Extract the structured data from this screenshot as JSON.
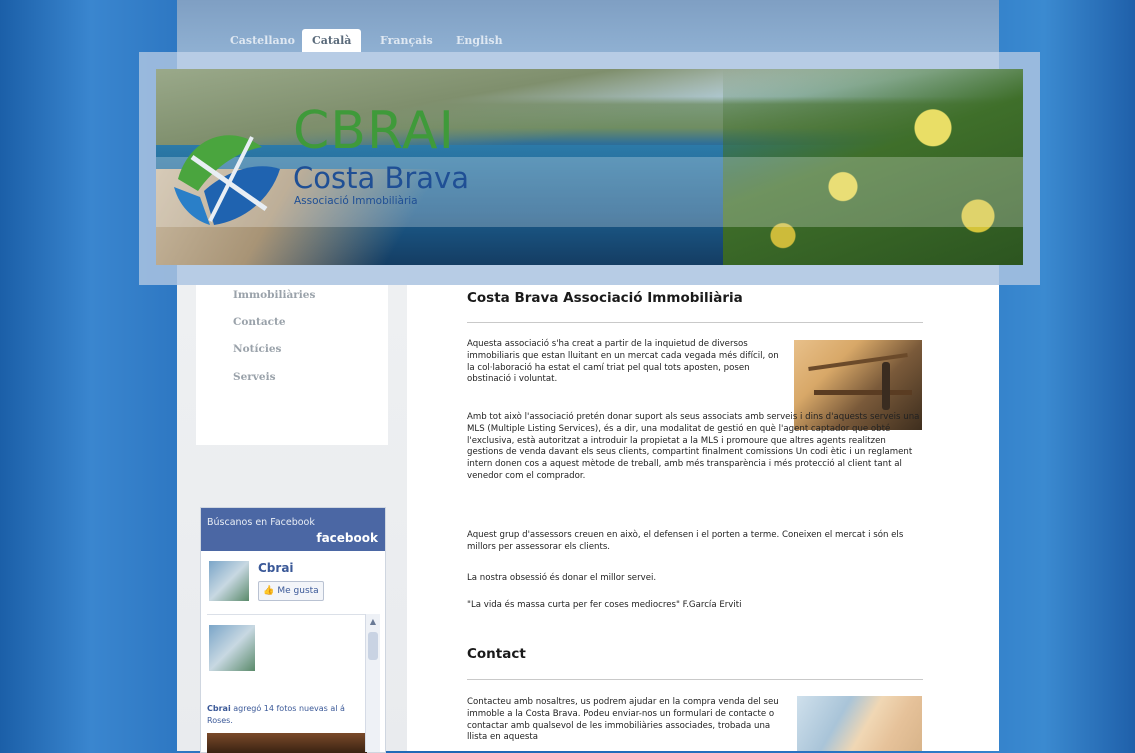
{
  "languages": [
    {
      "label": "Castellano",
      "active": false
    },
    {
      "label": "Català",
      "active": true
    },
    {
      "label": "Français",
      "active": false
    },
    {
      "label": "English",
      "active": false
    }
  ],
  "logo": {
    "cbrai": "CBRAI",
    "costa_brava": "Costa Brava",
    "subtitle": "Associació Immobiliària"
  },
  "menu": {
    "items": [
      "Immobiliàries",
      "Contacte",
      "Notícies",
      "Serveis"
    ]
  },
  "facebook": {
    "find_us": "Búscanos en Facebook",
    "brand": "facebook",
    "page_name": "Cbrai",
    "like_label": "Me gusta",
    "post_author": "Cbrai",
    "post_text": "agregó 14 fotos nuevas al á",
    "post_place": "Roses."
  },
  "main": {
    "title": "Costa Brava Associació Immobiliària",
    "paragraphs": [
      "Aquesta associació s'ha creat a partir de la inquietud de diversos immobiliaris que estan lluitant en un mercat cada vegada més difícil, on la col·laboració ha estat el camí triat pel qual tots aposten, posen obstinació i voluntat.",
      "Amb tot això l'associació pretén donar suport als seus associats amb serveis i dins d'aquests serveis una MLS (Multiple Listing Services), és a dir, una modalitat de gestió en què l'agent captador que obté l'exclusiva, està autoritzat a introduir la propietat a la MLS i promoure que altres agents realitzen gestions de venda davant els seus clients, compartint finalment comissions Un codi ètic i un reglament intern donen cos a aquest mètode de treball, amb més transparència i més protecció al client tant al venedor com el comprador.",
      "Aquest grup d'assessors creuen en això, el defensen i el porten a terme. Coneixen el mercat i són els millors per assessorar els clients.",
      "La nostra obsessió és donar el millor servei.",
      "\"La vida és massa curta per fer coses mediocres\" F.García Erviti"
    ],
    "contact_title": "Contact",
    "contact_text": "Contacteu amb nosaltres, us podrem ajudar en la compra venda del seu immoble a la Costa Brava. Podeu enviar-nos un formulari de contacte o contactar amb qualsevol de les immobiliàries associades, trobada una llista en aquesta"
  }
}
